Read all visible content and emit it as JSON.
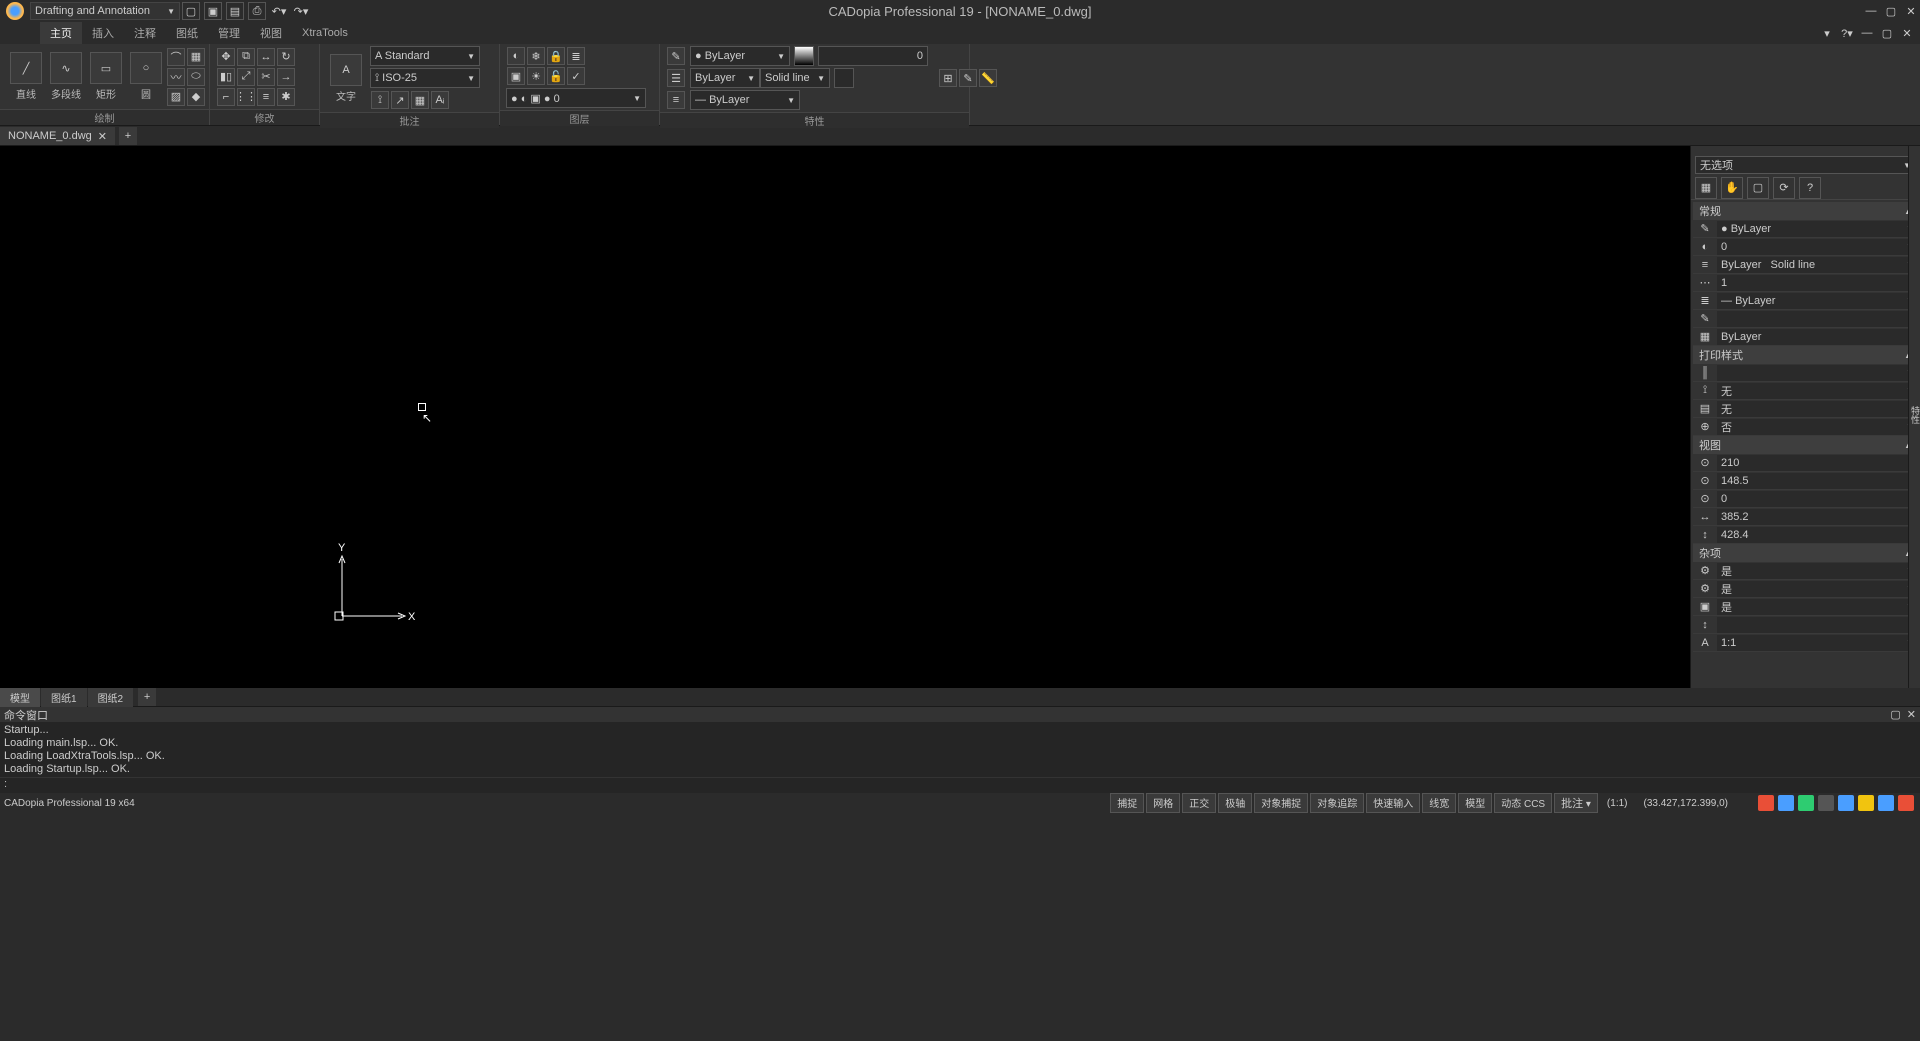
{
  "title": "CADopia Professional 19 - [NONAME_0.dwg]",
  "workspace": "Drafting and Annotation",
  "menu": [
    "主页",
    "插入",
    "注释",
    "图纸",
    "管理",
    "视图",
    "XtraTools"
  ],
  "ribbon": {
    "draw": {
      "label": "绘制",
      "items": [
        "直线",
        "多段线",
        "矩形",
        "圆"
      ]
    },
    "modify": {
      "label": "修改"
    },
    "annotate": {
      "label": "批注",
      "text_label": "文字",
      "style1": "Standard",
      "style2": "ISO-25"
    },
    "layers": {
      "label": "图层",
      "current": "0"
    },
    "props": {
      "label": "特性",
      "color": "ByLayer",
      "ltype1": "ByLayer",
      "ltype2": "Solid line",
      "lweight": "ByLayer",
      "transparency": "0"
    }
  },
  "doc_tab": "NONAME_0.dwg",
  "layout_tabs": [
    "模型",
    "图纸1",
    "图纸2"
  ],
  "prop_panel": {
    "header": "无选项",
    "sections": {
      "general": {
        "title": "常规",
        "color": "ByLayer",
        "layer": "0",
        "ltype": "ByLayer",
        "ltype2": "Solid line",
        "lscale": "1",
        "lweight": "ByLayer",
        "thickness": "",
        "material": "ByLayer"
      },
      "plot": {
        "title": "打印样式",
        "val1": "",
        "val2": "无",
        "val3": "无",
        "val4": "否"
      },
      "view": {
        "title": "视图",
        "v1": "210",
        "v2": "148.5",
        "v3": "0",
        "v4": "385.2",
        "v5": "428.4"
      },
      "misc": {
        "title": "杂项",
        "m1": "是",
        "m2": "是",
        "m3": "是",
        "m4": "",
        "m5": "1:1"
      }
    }
  },
  "cmd": {
    "title": "命令窗口",
    "lines": [
      "Startup...",
      "Loading main.lsp...   OK.",
      "Loading LoadXtraTools.lsp...   OK.",
      "Loading Startup.lsp...   OK."
    ],
    "prompt": ":"
  },
  "status": {
    "product": "CADopia Professional 19 x64",
    "buttons": [
      "捕捉",
      "网格",
      "正交",
      "极轴",
      "对象捕捉",
      "对象追踪",
      "快速输入",
      "线宽",
      "模型",
      "动态 CCS",
      "批注"
    ],
    "ratio": "(1:1)",
    "coords": "(33.427,172.399,0)"
  }
}
